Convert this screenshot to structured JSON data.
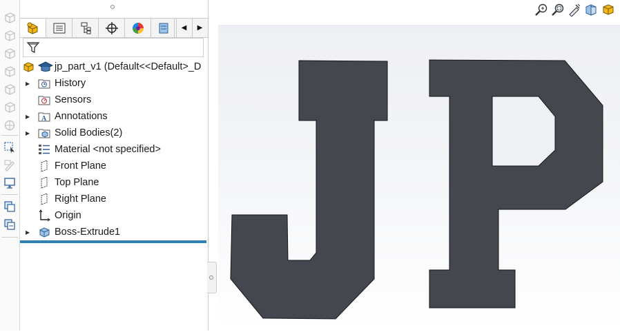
{
  "toolbar": {
    "tabs": [
      "feature-manager",
      "property-manager",
      "configuration-manager",
      "dimxpert-manager",
      "display-manager",
      "cam-manager"
    ],
    "scroll_left_icon": "triangle-left-icon",
    "scroll_right_icon": "triangle-right-icon"
  },
  "filter": {
    "icon": "funnel-icon"
  },
  "tree": {
    "root": {
      "label": "jp_part_v1  (Default<<Default>_D"
    },
    "items": [
      {
        "label": "History",
        "icon": "history-folder-icon",
        "expandable": true
      },
      {
        "label": "Sensors",
        "icon": "sensors-folder-icon",
        "expandable": false
      },
      {
        "label": "Annotations",
        "icon": "annotations-folder-icon",
        "expandable": true
      },
      {
        "label": "Solid Bodies(2)",
        "icon": "solid-bodies-folder-icon",
        "expandable": true
      },
      {
        "label": "Material <not specified>",
        "icon": "material-icon",
        "expandable": false
      },
      {
        "label": "Front Plane",
        "icon": "plane-icon",
        "expandable": false
      },
      {
        "label": "Top Plane",
        "icon": "plane-icon",
        "expandable": false
      },
      {
        "label": "Right Plane",
        "icon": "plane-icon",
        "expandable": false
      },
      {
        "label": "Origin",
        "icon": "origin-icon",
        "expandable": false
      },
      {
        "label": "Boss-Extrude1",
        "icon": "extrude-feature-icon",
        "expandable": true
      }
    ]
  },
  "viewport": {
    "model_text": "JP",
    "model_color": "#45474f",
    "tools": [
      "zoom-to-fit-icon",
      "zoom-to-area-icon",
      "previous-view-icon",
      "section-view-icon",
      "view-orientation-icon"
    ]
  }
}
